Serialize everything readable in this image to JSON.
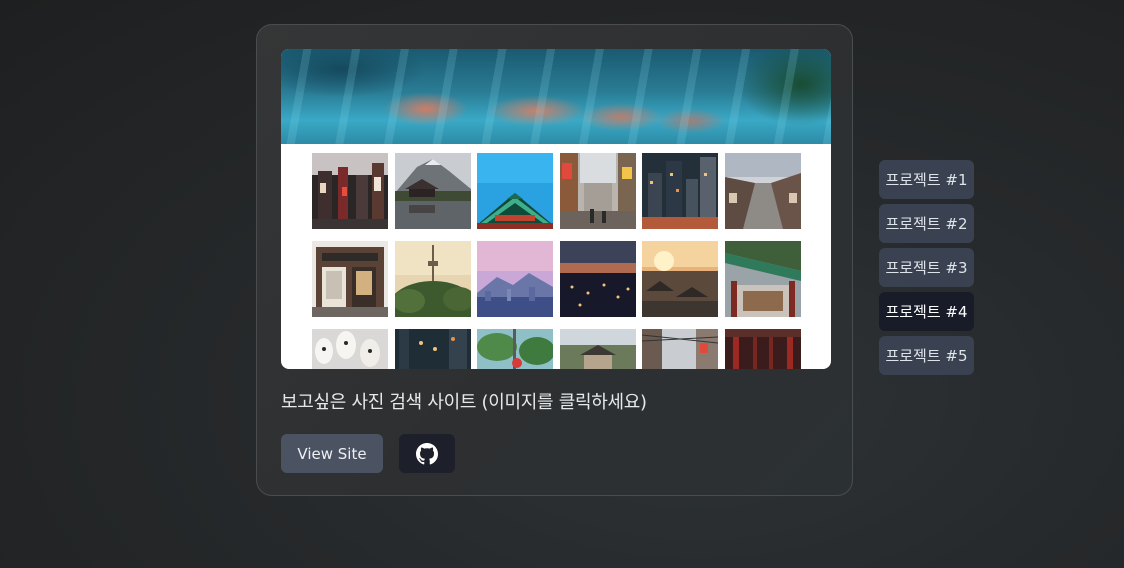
{
  "card": {
    "title": "보고싶은 사진 검색 사이트 (이미지를 클릭하세요)",
    "view_site_label": "View Site",
    "github_icon": "github-icon",
    "preview": {
      "hero": "lake-with-mountain-reflection-banner",
      "thumbnails": [
        "seoul-street-night-signs",
        "mountain-and-palace-pond",
        "palace-eaves-blue-sky",
        "busy-shopping-street",
        "city-skyscrapers-dusk",
        "hanok-alley",
        "storefront-korean-sign",
        "namsan-tower-sunset",
        "purple-sky-city-skyline",
        "city-night-panorama",
        "hanok-rooftops-sunset",
        "palace-painted-eaves",
        "white-paper-lanterns",
        "night-street-lights",
        "trees-and-lamp",
        "palace-aerial-view",
        "power-lines-alley",
        "palace-red-corridor"
      ]
    }
  },
  "projects": [
    {
      "label": "프로젝트 #1",
      "active": false
    },
    {
      "label": "프로젝트 #2",
      "active": false
    },
    {
      "label": "프로젝트 #3",
      "active": false
    },
    {
      "label": "프로젝트 #4",
      "active": true
    },
    {
      "label": "프로젝트 #5",
      "active": false
    }
  ],
  "colors": {
    "active_project_bg": "#181b28",
    "project_bg": "#3a4150",
    "view_site_bg": "#4b5262",
    "github_button_bg": "#1d1f2a"
  }
}
